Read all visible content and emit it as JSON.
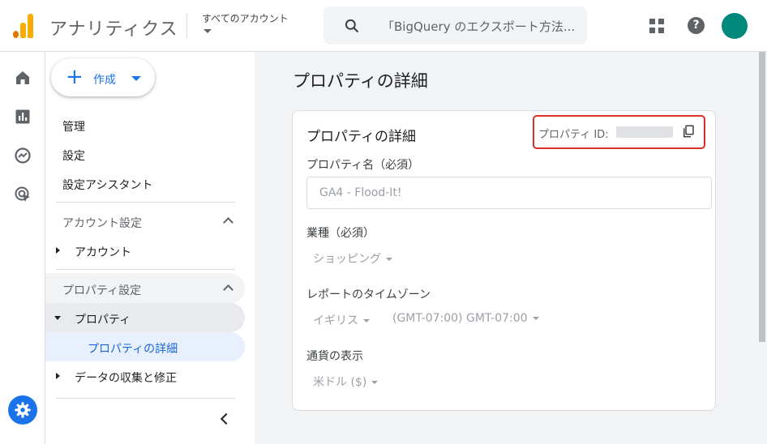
{
  "header": {
    "app_title": "アナリティクス",
    "account_label": "すべてのアカウント",
    "search_text": "「BigQuery のエクスポート方法...",
    "brand_colors": {
      "logo_orange": "#f9ab00",
      "logo_dark": "#e37400",
      "avatar": "#00897b"
    }
  },
  "sidebar": {
    "create_label": "作成",
    "items": {
      "admin": "管理",
      "settings": "設定",
      "setup_assistant": "設定アシスタント",
      "account_settings": "アカウント設定",
      "account": "アカウント",
      "property_settings": "プロパティ設定",
      "property": "プロパティ",
      "property_details": "プロパティの詳細",
      "data_collection": "データの収集と修正"
    }
  },
  "main": {
    "title": "プロパティの詳細",
    "card": {
      "title": "プロパティの詳細",
      "property_id_label": "プロパティ ID:",
      "property_name_label": "プロパティ名（必須）",
      "property_name_value": "GA4 - Flood-It!",
      "industry_label": "業種（必須）",
      "industry_value": "ショッピング",
      "timezone_label": "レポートのタイムゾーン",
      "timezone_country": "イギリス",
      "timezone_value": "(GMT-07:00) GMT-07:00",
      "currency_label": "通貨の表示",
      "currency_value": "米ドル ($)"
    }
  }
}
